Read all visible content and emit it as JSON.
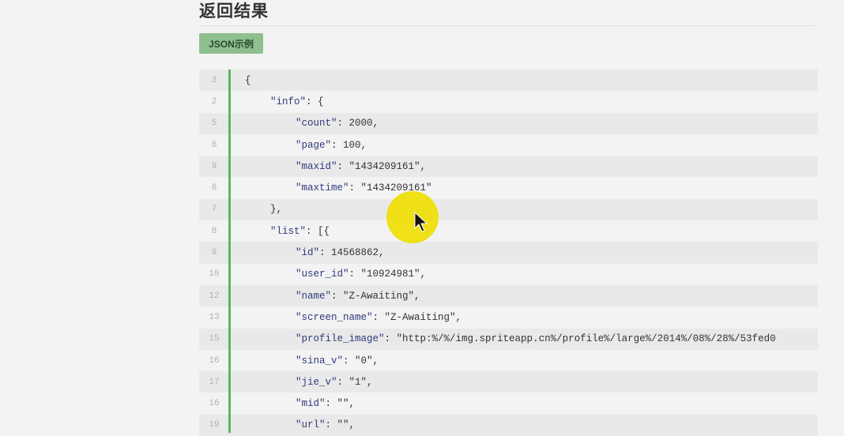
{
  "section_title": "返回结果",
  "example_button": "JSON示例",
  "code_lines": [
    {
      "ln": "3",
      "indent": 0,
      "key": "",
      "rest": "{"
    },
    {
      "ln": "2",
      "indent": 1,
      "key": "\"info\"",
      "rest": ": {"
    },
    {
      "ln": "5",
      "indent": 2,
      "key": "\"count\"",
      "rest": ": 2000,"
    },
    {
      "ln": "6",
      "indent": 2,
      "key": "\"page\"",
      "rest": ": 100,"
    },
    {
      "ln": "9",
      "indent": 2,
      "key": "\"maxid\"",
      "rest": ": \"1434209161\","
    },
    {
      "ln": "6",
      "indent": 2,
      "key": "\"maxtime\"",
      "rest": ": \"1434209161\""
    },
    {
      "ln": "7",
      "indent": 1,
      "key": "",
      "rest": "},"
    },
    {
      "ln": "8",
      "indent": 1,
      "key": "\"list\"",
      "rest": ": [{"
    },
    {
      "ln": "9",
      "indent": 2,
      "key": "\"id\"",
      "rest": ": 14568862,"
    },
    {
      "ln": "10",
      "indent": 2,
      "key": "\"user_id\"",
      "rest": ": \"10924981\","
    },
    {
      "ln": "12",
      "indent": 2,
      "key": "\"name\"",
      "rest": ": \"Z-Awaiting\","
    },
    {
      "ln": "13",
      "indent": 2,
      "key": "\"screen_name\"",
      "rest": ": \"Z-Awaiting\","
    },
    {
      "ln": "15",
      "indent": 2,
      "key": "\"profile_image\"",
      "rest": ": \"http:%/%/img.spriteapp.cn%/profile%/large%/2014%/08%/28%/53fed0"
    },
    {
      "ln": "16",
      "indent": 2,
      "key": "\"sina_v\"",
      "rest": ": \"0\","
    },
    {
      "ln": "17",
      "indent": 2,
      "key": "\"jie_v\"",
      "rest": ": \"1\","
    },
    {
      "ln": "16",
      "indent": 2,
      "key": "\"mid\"",
      "rest": ": \"\","
    },
    {
      "ln": "19",
      "indent": 2,
      "key": "\"url\"",
      "rest": ": \"\","
    }
  ]
}
